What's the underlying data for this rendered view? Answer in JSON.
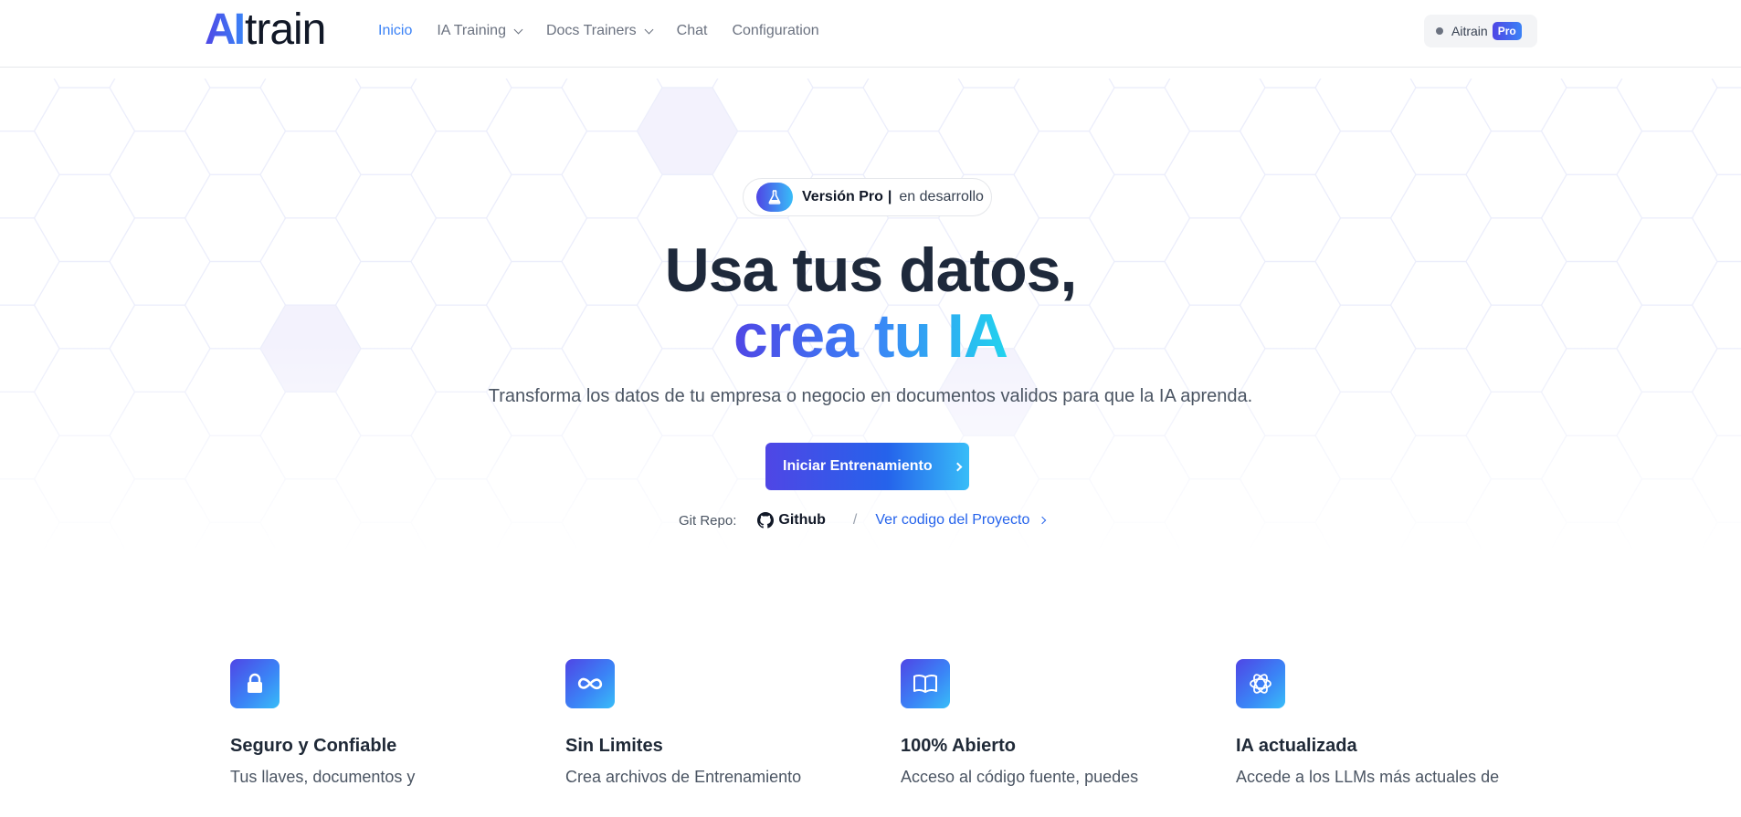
{
  "header": {
    "logo": {
      "part1": "AI",
      "part2": "train"
    },
    "nav": [
      {
        "label": "Inicio",
        "active": true,
        "dropdown": false
      },
      {
        "label": "IA Training",
        "active": false,
        "dropdown": true
      },
      {
        "label": "Docs Trainers",
        "active": false,
        "dropdown": true
      },
      {
        "label": "Chat",
        "active": false,
        "dropdown": false
      },
      {
        "label": "Configuration",
        "active": false,
        "dropdown": false
      }
    ],
    "user": {
      "name": "Aitrain",
      "badge": "Pro"
    }
  },
  "hero": {
    "pill": {
      "icon": "flask-icon",
      "strong": "Versión Pro",
      "separator": "|",
      "light": "en desarrollo"
    },
    "title_line1": "Usa tus datos,",
    "title_line2": "crea tu IA",
    "subtitle": "Transforma los datos de tu empresa o negocio en documentos validos para que la IA aprenda.",
    "cta_label": "Iniciar Entrenamiento",
    "repo": {
      "label": "Git Repo:",
      "github_label": "Github",
      "separator": "/",
      "project_link": "Ver codigo del Proyecto"
    }
  },
  "features": [
    {
      "icon": "lock-icon",
      "title": "Seguro y Confiable",
      "desc": "Tus llaves, documentos y"
    },
    {
      "icon": "infinity-icon",
      "title": "Sin Limites",
      "desc": "Crea archivos de Entrenamiento"
    },
    {
      "icon": "book-icon",
      "title": "100% Abierto",
      "desc": "Acceso al código fuente, puedes"
    },
    {
      "icon": "openai-icon",
      "title": "IA actualizada",
      "desc": "Accede a los LLMs más actuales de"
    }
  ],
  "colors": {
    "accent": "#3b82f6",
    "gradient_start": "#4f46e5",
    "gradient_end": "#38bdf8",
    "title": "#1e293b"
  }
}
